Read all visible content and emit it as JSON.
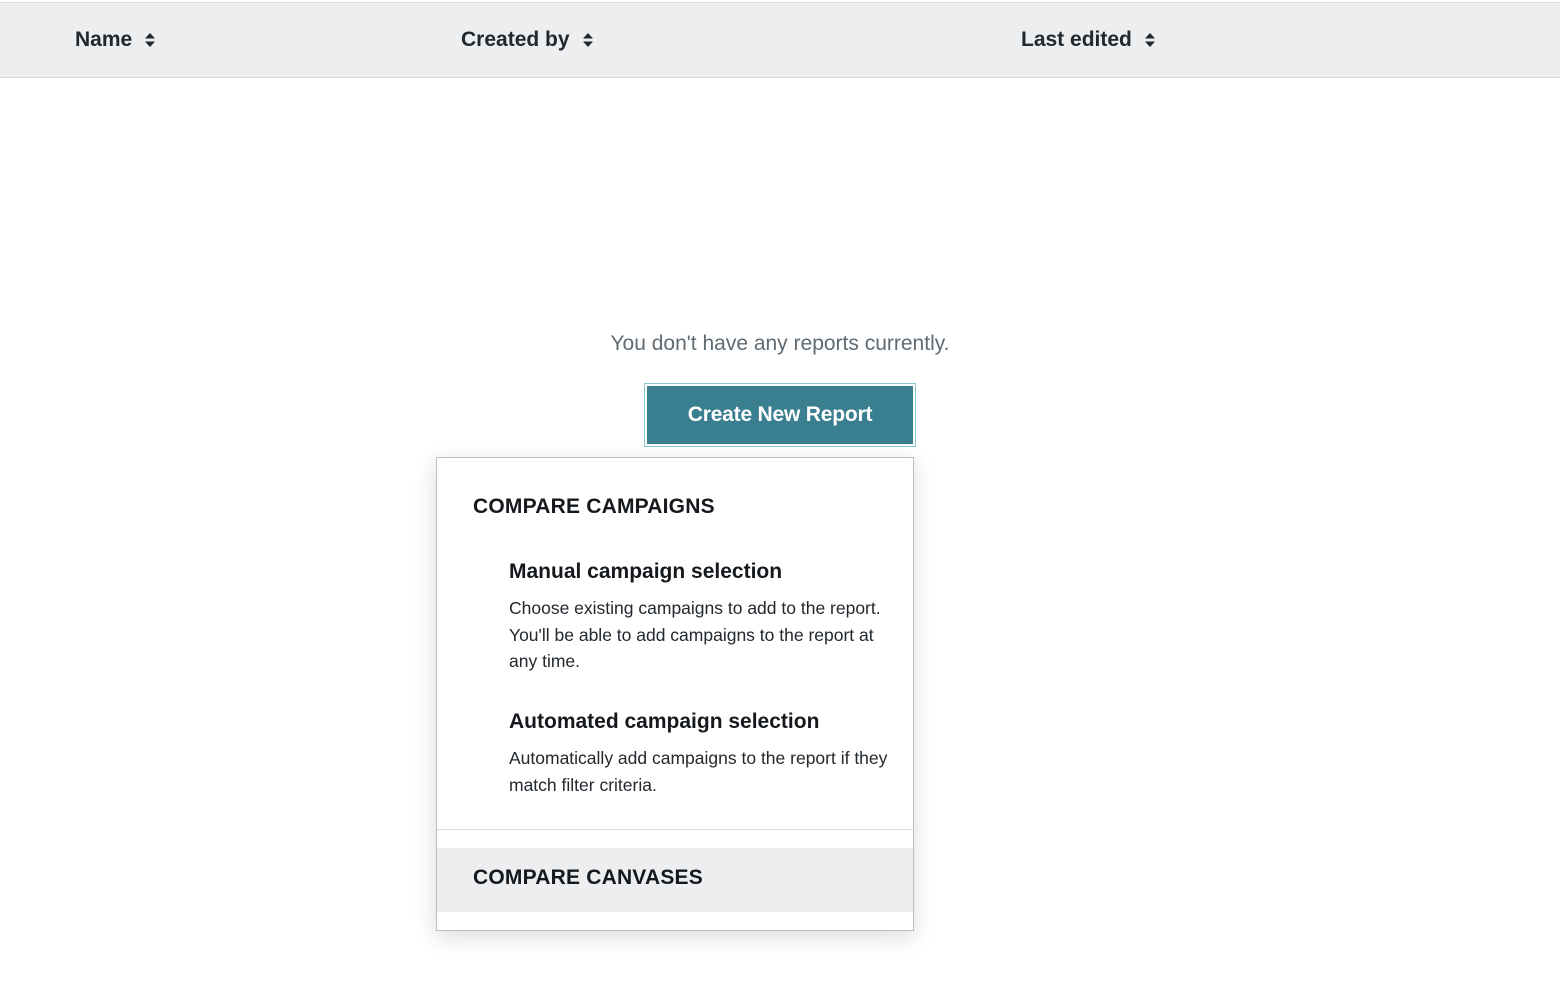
{
  "table": {
    "columns": [
      {
        "label": "Name",
        "icon": "sort-icon"
      },
      {
        "label": "Created by",
        "icon": "sort-icon"
      },
      {
        "label": "Last edited",
        "icon": "sort-icon"
      }
    ]
  },
  "empty_state": {
    "message": "You don't have any reports currently.",
    "create_button_label": "Create New Report"
  },
  "dropdown": {
    "compare_campaigns": {
      "title": "COMPARE CAMPAIGNS",
      "options": [
        {
          "title": "Manual campaign selection",
          "description": "Choose existing campaigns to add to the report. You'll be able to add campaigns to the report at any time."
        },
        {
          "title": "Automated campaign selection",
          "description": "Automatically add campaigns to the report if they match filter criteria."
        }
      ]
    },
    "compare_canvases": {
      "title": "COMPARE CANVASES"
    }
  },
  "colors": {
    "header_bg": "#eceeef",
    "button_bg": "#3a7f90",
    "button_focus_ring": "#8ec7d3",
    "muted_text": "#5f6b73",
    "hover_row_bg": "#eceeef"
  }
}
